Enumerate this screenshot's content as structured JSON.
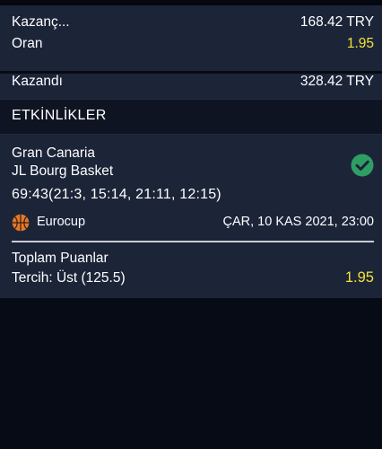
{
  "summary": {
    "rows": [
      {
        "label": "Kazanç...",
        "value": "168.42 TRY"
      },
      {
        "label": "Oran",
        "value": "1.95"
      },
      {
        "label": "Kazandı",
        "value": "328.42 TRY"
      }
    ]
  },
  "section": {
    "title": "ETKİNLİKLER"
  },
  "event": {
    "home_team": "Gran Canaria",
    "away_team": "JL Bourg Basket",
    "score": "69:43(21:3, 15:14, 21:11, 12:15)",
    "league": "Eurocup",
    "league_icon": "basketball-icon",
    "date": "ÇAR, 10 KAS 2021, 23:00",
    "status_icon": "check-circle-icon",
    "market": "Toplam Puanlar",
    "pick": "Tercih: Üst (125.5)",
    "odds": "1.95"
  },
  "colors": {
    "card_bg": "#1c2438",
    "page_bg": "#070b15",
    "odds_yellow": "#f3e23a",
    "win_green": "#2e9e63",
    "basketball_orange": "#e07a2e"
  }
}
